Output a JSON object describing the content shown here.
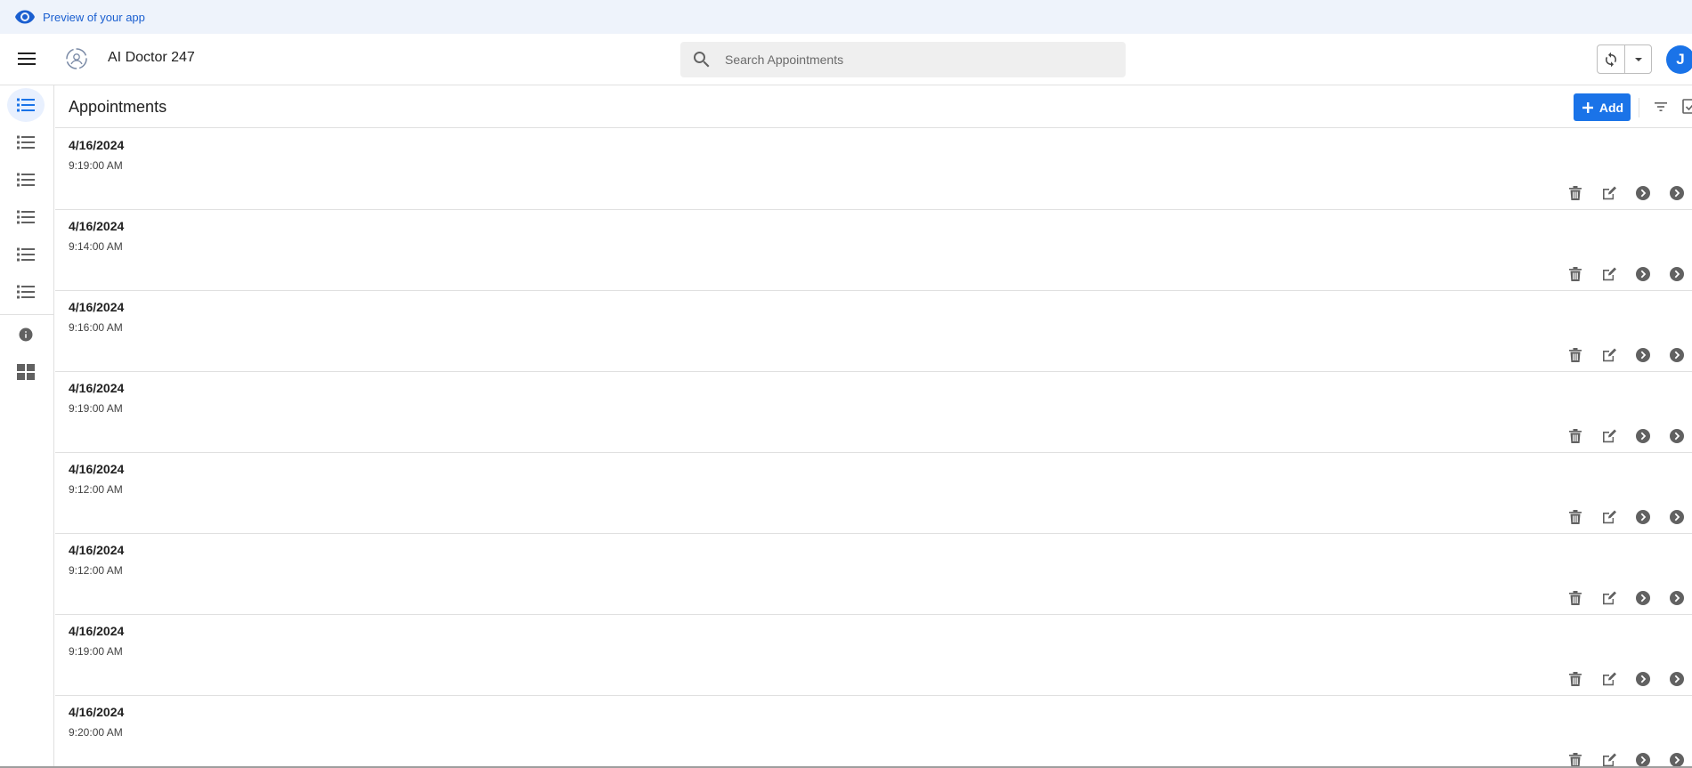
{
  "preview": {
    "text": "Preview of your app"
  },
  "header": {
    "app_name": "AI Doctor 247",
    "search_placeholder": "Search Appointments",
    "avatar_initial": "J"
  },
  "colors": {
    "accent": "#1a73e8",
    "preview_text": "#1a5fd0",
    "icon_gray": "#616161"
  },
  "sidebar": {
    "items": [
      {
        "icon": "list-icon",
        "active": true
      },
      {
        "icon": "list-icon"
      },
      {
        "icon": "list-icon"
      },
      {
        "icon": "list-icon"
      },
      {
        "icon": "list-icon"
      },
      {
        "icon": "list-icon"
      },
      {
        "icon": "info-icon"
      },
      {
        "icon": "dashboard-icon"
      }
    ]
  },
  "toolbar": {
    "title": "Appointments",
    "add_label": "Add"
  },
  "appointments": [
    {
      "date": "4/16/2024",
      "time": "9:19:00 AM"
    },
    {
      "date": "4/16/2024",
      "time": "9:14:00 AM"
    },
    {
      "date": "4/16/2024",
      "time": "9:16:00 AM"
    },
    {
      "date": "4/16/2024",
      "time": "9:19:00 AM"
    },
    {
      "date": "4/16/2024",
      "time": "9:12:00 AM"
    },
    {
      "date": "4/16/2024",
      "time": "9:12:00 AM"
    },
    {
      "date": "4/16/2024",
      "time": "9:19:00 AM"
    },
    {
      "date": "4/16/2024",
      "time": "9:20:00 AM"
    }
  ]
}
